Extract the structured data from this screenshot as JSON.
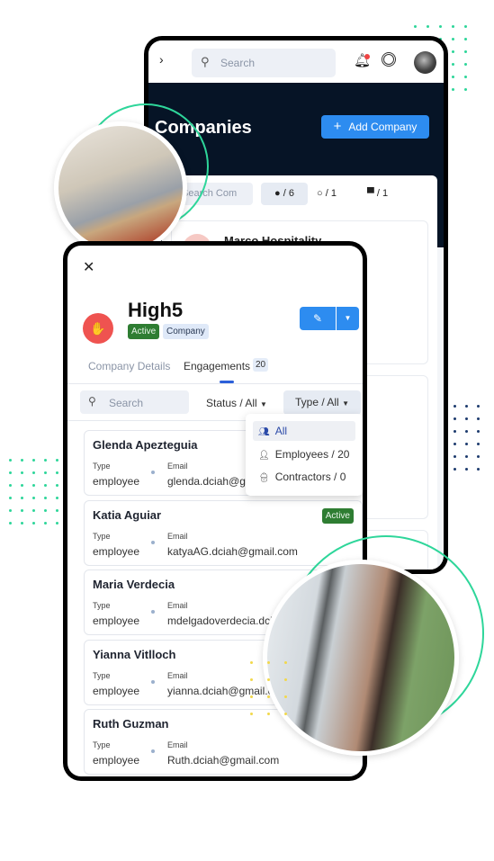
{
  "colors": {
    "accent": "#2d8cf0",
    "navy": "#061426",
    "active": "#2e7d32",
    "ring": "#2ed69a",
    "logo": "#ef5350"
  },
  "back": {
    "search_placeholder": "Search",
    "title": "Companies",
    "add_button": "Add Company",
    "search_companies_placeholder": "Search Com",
    "filters": [
      {
        "icon": "toggle-on-icon",
        "label": "/ 6"
      },
      {
        "icon": "toggle-off-icon",
        "label": "/ 1"
      },
      {
        "icon": "archive-icon",
        "label": "/ 1"
      }
    ],
    "first_company": "Marco Hospitality"
  },
  "front": {
    "company_name": "High5",
    "status_badge": "Active",
    "type_badge": "Company",
    "tabs": [
      {
        "label": "Company Details"
      },
      {
        "label": "Engagements",
        "count": "20"
      }
    ],
    "search_placeholder": "Search",
    "status_filter": "Status / All",
    "type_filter": "Type / All",
    "dropdown": [
      {
        "icon": "users-icon",
        "label": "All"
      },
      {
        "icon": "employee-icon",
        "label": "Employees / 20"
      },
      {
        "icon": "contractor-icon",
        "label": "Contractors / 0"
      }
    ],
    "type_label": "Type",
    "email_label": "Email",
    "engagements": [
      {
        "name": "Glenda Apezteguia",
        "type": "employee",
        "email": "glenda.dciah@gmail.com"
      },
      {
        "name": "Katia Aguiar",
        "type": "employee",
        "email": "katyaAG.dciah@gmail.com",
        "status": "Active"
      },
      {
        "name": "Maria Verdecia",
        "type": "employee",
        "email": "mdelgadoverdecia.dciah@gmail.com"
      },
      {
        "name": "Yianna Vitlloch",
        "type": "employee",
        "email": "yianna.dciah@gmail.com"
      },
      {
        "name": "Ruth Guzman",
        "type": "employee",
        "email": "Ruth.dciah@gmail.com"
      }
    ]
  }
}
